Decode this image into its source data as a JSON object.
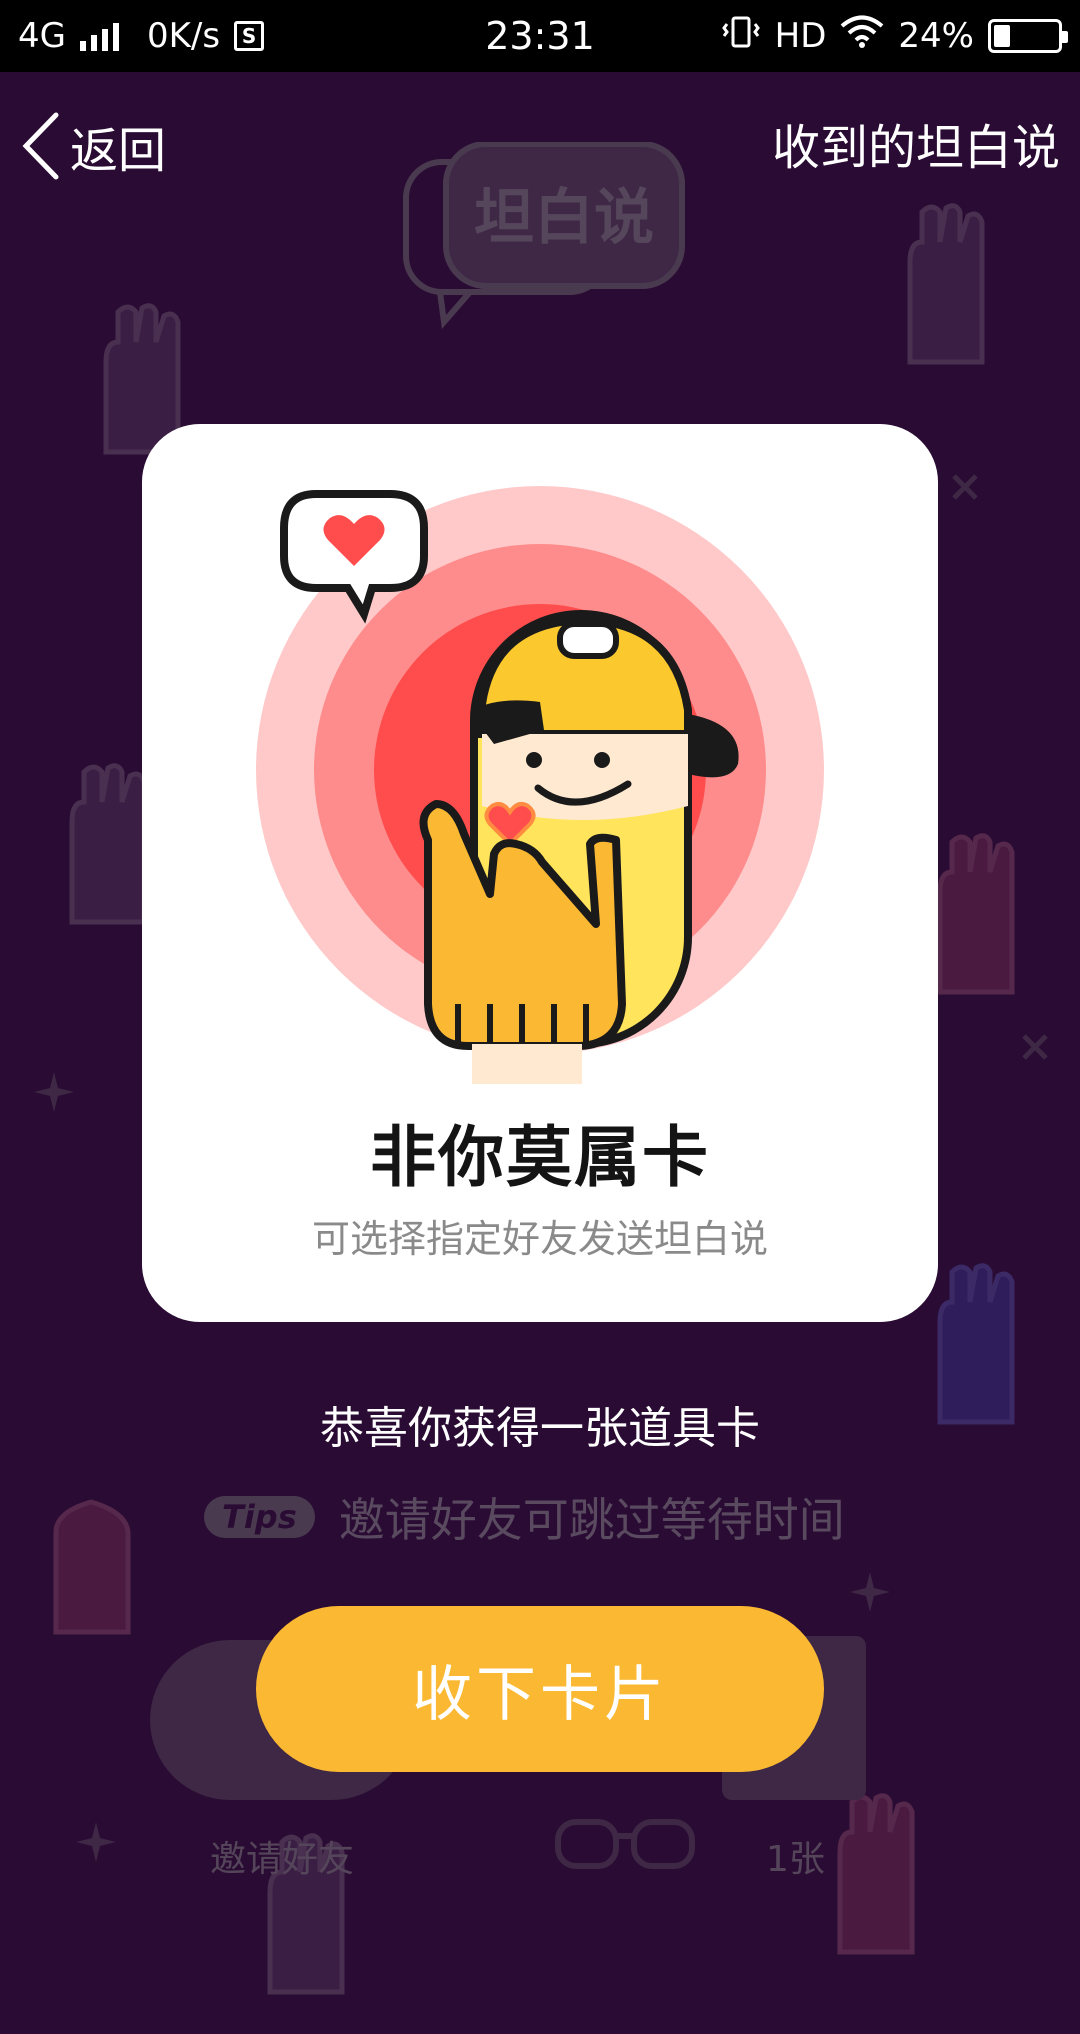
{
  "status_bar": {
    "network": "4G",
    "speed": "0K/s",
    "storage_badge": "S",
    "time": "23:31",
    "hd": "HD",
    "battery": "24%"
  },
  "header": {
    "back_label": "返回",
    "received_label": "收到的坦白说",
    "logo_text": "坦白说"
  },
  "card": {
    "title": "非你莫属卡",
    "subtitle": "可选择指定好友发送坦白说",
    "illustration": "character-finger-heart"
  },
  "congrats_text": "恭喜你获得一张道具卡",
  "tips": {
    "badge": "Tips",
    "text": "邀请好友可跳过等待时间"
  },
  "background_actions": {
    "invite_label": "邀请好友",
    "count_label": "1张"
  },
  "accept_button_label": "收下卡片",
  "colors": {
    "background": "#2a0b33",
    "accent": "#fbb933",
    "card": "#ffffff",
    "ring_outer": "#ffc9c9",
    "ring_mid": "#ff8c8c",
    "ring_inner": "#ff4d4d"
  }
}
